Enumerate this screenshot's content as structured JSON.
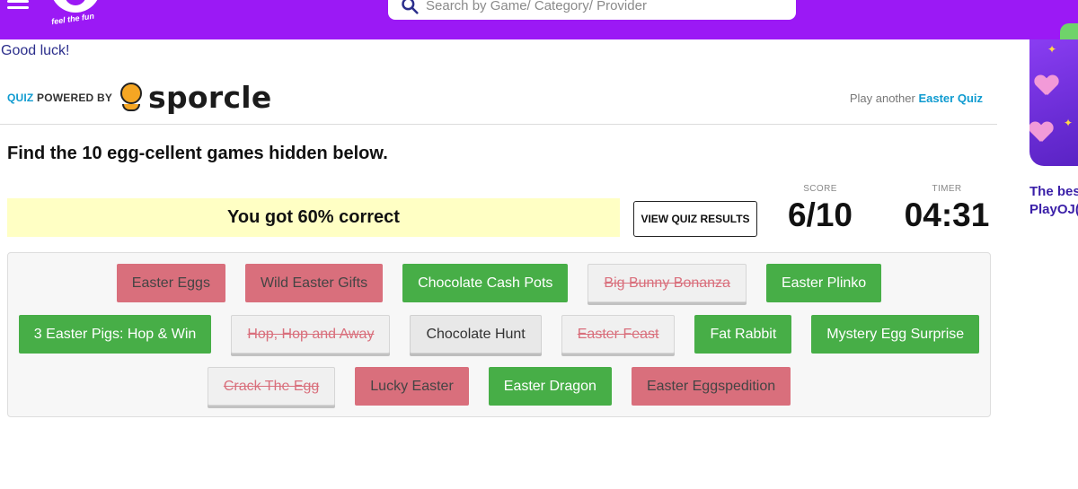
{
  "header": {
    "logo_tagline": "feel the fun",
    "search_placeholder": "Search by Game/ Category/ Provider",
    "brand_color": "#9b19f5"
  },
  "intro_text": "Good luck!",
  "sporcle": {
    "quiz_label": "QUIZ",
    "powered_by": "POWERED BY",
    "brand_name": "sporcle",
    "play_another_prefix": "Play another",
    "play_another_link": "Easter Quiz"
  },
  "quiz": {
    "instructions": "Find the 10 egg-cellent games hidden below.",
    "result_text": "You got 60% correct",
    "view_results_label": "VIEW QUIZ RESULTS",
    "score_label": "SCORE",
    "score_value": "6/10",
    "timer_label": "TIMER",
    "timer_value": "04:31"
  },
  "game_rows": [
    [
      {
        "label": "Easter Eggs",
        "state": "wrong"
      },
      {
        "label": "Wild Easter Gifts",
        "state": "wrong"
      },
      {
        "label": "Chocolate Cash Pots",
        "state": "correct"
      },
      {
        "label": "Big Bunny Bonanza",
        "state": "missed"
      },
      {
        "label": "Easter Plinko",
        "state": "correct"
      }
    ],
    [
      {
        "label": "3 Easter Pigs: Hop & Win",
        "state": "correct"
      },
      {
        "label": "Hop, Hop and Away",
        "state": "missed"
      },
      {
        "label": "Chocolate Hunt",
        "state": "neutral"
      },
      {
        "label": "Easter Feast",
        "state": "missed"
      },
      {
        "label": "Fat Rabbit",
        "state": "correct"
      },
      {
        "label": "Mystery Egg Surprise",
        "state": "correct"
      }
    ],
    [
      {
        "label": "Crack The Egg",
        "state": "missed"
      },
      {
        "label": "Lucky Easter",
        "state": "wrong"
      },
      {
        "label": "Easter Dragon",
        "state": "correct"
      },
      {
        "label": "Easter Eggspedition",
        "state": "wrong"
      }
    ]
  ],
  "colors": {
    "correct": "#47ae47",
    "wrong": "#d96f7c",
    "banner": "#ffffc4",
    "link": "#0f9bd0"
  },
  "sidebar_ad": {
    "caption_line1": "The bes",
    "caption_line2": "PlayOJ("
  }
}
